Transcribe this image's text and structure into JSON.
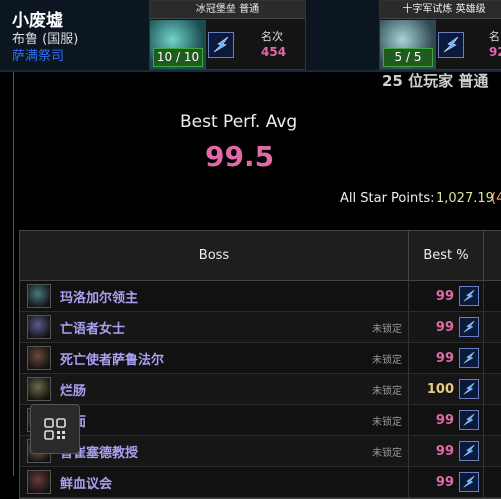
{
  "character": {
    "name": "小废墟",
    "realm": "布鲁 (国服)",
    "spec": "萨满祭司"
  },
  "raids": [
    {
      "title": "冰冠堡垒 普通",
      "kills": "10 / 10",
      "rank_label": "名次",
      "rank_value": "454"
    },
    {
      "title": "十字军试炼 英雄级",
      "kills": "5 / 5",
      "rank_label": "名",
      "rank_value": "92"
    }
  ],
  "summary": {
    "cut_text": "25 位玩家 普通",
    "best_perf_label": "Best Perf. Avg",
    "best_perf_value": "99.5",
    "star_points_label": "All Star Points:",
    "star_points_value": "1,027.19",
    "star_points_extra": "(4"
  },
  "table": {
    "headers": {
      "boss": "Boss",
      "best": "Best %"
    },
    "rows": [
      {
        "name": "玛洛加尔领主",
        "locked": "",
        "best": "99",
        "icon_color": "#4a7a80"
      },
      {
        "name": "亡语者女士",
        "locked": "未锁定",
        "best": "99",
        "icon_color": "#5a5a8a"
      },
      {
        "name": "死亡使者萨鲁法尔",
        "locked": "未锁定",
        "best": "99",
        "icon_color": "#6a4a3a"
      },
      {
        "name": "烂肠",
        "locked": "未锁定",
        "best": "100",
        "icon_color": "#6a6a4a"
      },
      {
        "name": "脓面",
        "locked": "未锁定",
        "best": "99",
        "icon_color": "#5a6a3a"
      },
      {
        "name": "普崔塞德教授",
        "locked": "未锁定",
        "best": "99",
        "icon_color": "#7a5a4a"
      },
      {
        "name": "鲜血议会",
        "locked": "",
        "best": "99",
        "icon_color": "#6a3a3a"
      }
    ]
  },
  "colors": {
    "pink": "#e268a8",
    "gold": "#e5cc80",
    "boss_name": "#a8a0f0",
    "spec_blue": "#2e6ff5"
  },
  "icons": {
    "spec": "lightning-icon",
    "qr": "qr-code-icon"
  }
}
